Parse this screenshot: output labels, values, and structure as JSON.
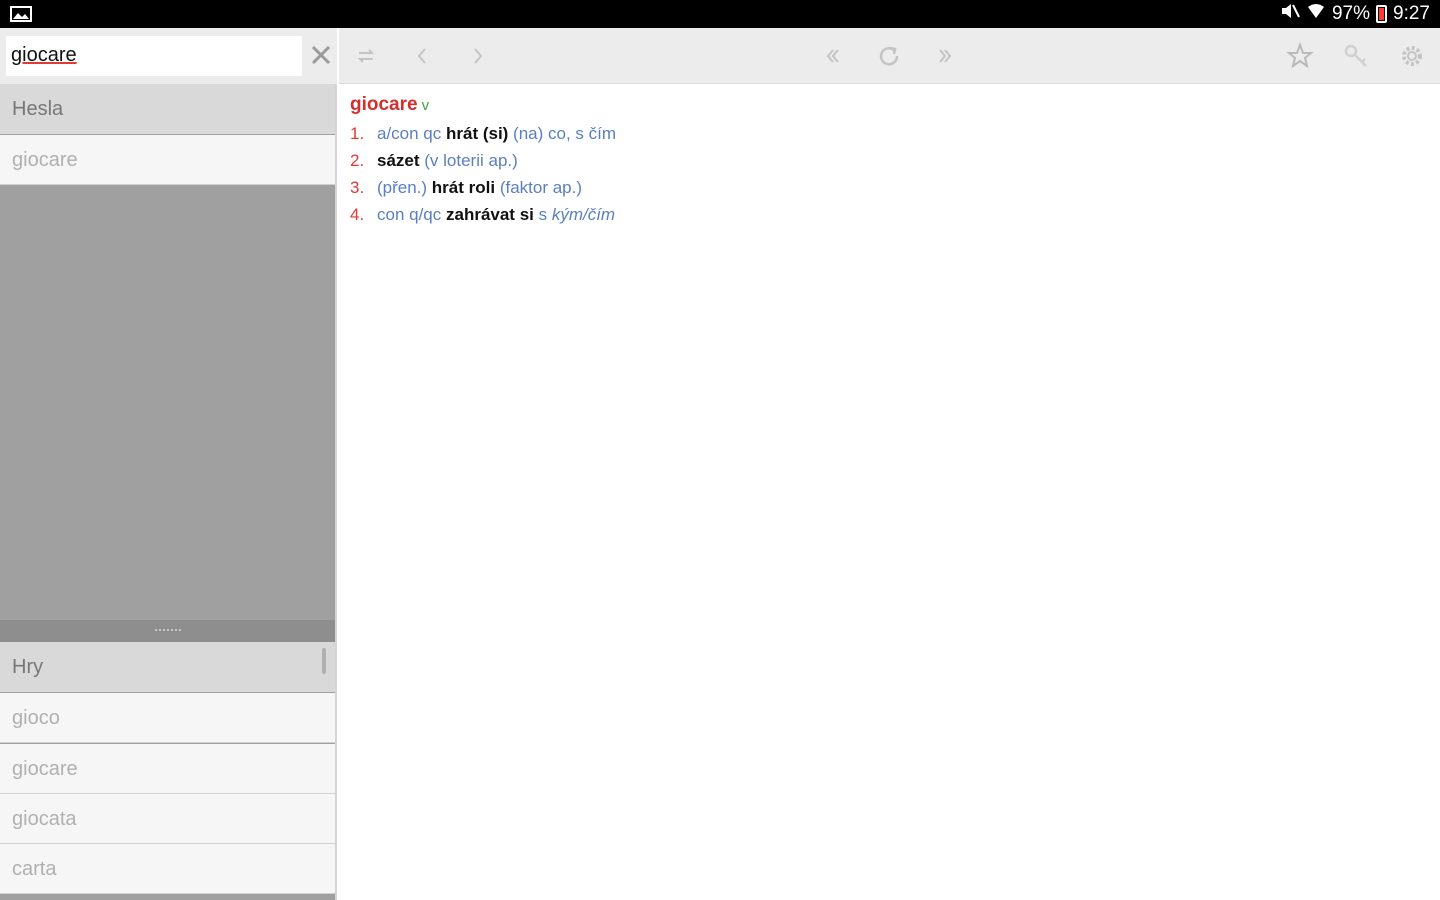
{
  "status_bar": {
    "battery_percent": "97%",
    "time": "9:27",
    "icons": [
      "image-icon",
      "mute-icon",
      "wifi-icon",
      "battery-icon"
    ]
  },
  "search": {
    "value": "giocare",
    "clear_icon": "close-icon"
  },
  "results_section": {
    "header": "Hesla",
    "items": [
      {
        "label": "giocare"
      }
    ]
  },
  "games_section": {
    "header": "Hry",
    "items": [
      {
        "label": "gioco"
      },
      {
        "label": "giocare"
      },
      {
        "label": "giocata"
      },
      {
        "label": "carta"
      }
    ]
  },
  "toolbar": {
    "icons": [
      "swap-icon",
      "back-icon",
      "forward-icon",
      "first-icon",
      "refresh-icon",
      "last-icon",
      "star-icon",
      "key-icon",
      "settings-icon"
    ]
  },
  "entry": {
    "headword": "giocare",
    "pos": "v",
    "senses": [
      {
        "num": "1.",
        "parts": [
          {
            "t": "a/con qc",
            "s": "blue"
          },
          {
            "t": " hrát (si)",
            "s": "bold"
          },
          {
            "t": " (na) co, s čím",
            "s": "blue"
          }
        ]
      },
      {
        "num": "2.",
        "parts": [
          {
            "t": "sázet",
            "s": "bold"
          },
          {
            "t": " (v loterii ap.)",
            "s": "blue"
          }
        ]
      },
      {
        "num": "3.",
        "parts": [
          {
            "t": "(přen.)",
            "s": "blue"
          },
          {
            "t": " hrát roli",
            "s": "bold"
          },
          {
            "t": " (faktor ap.)",
            "s": "blue"
          }
        ]
      },
      {
        "num": "4.",
        "parts": [
          {
            "t": "con q/qc",
            "s": "blue"
          },
          {
            "t": " zahrávat si",
            "s": "bold"
          },
          {
            "t": " s ",
            "s": "blue"
          },
          {
            "t": "kým/čím",
            "s": "ital"
          }
        ]
      }
    ]
  },
  "colors": {
    "headword": "#d32f2f",
    "pos": "#43a047",
    "sense_number": "#e53935",
    "grammar_blue": "#5a7fc0"
  }
}
